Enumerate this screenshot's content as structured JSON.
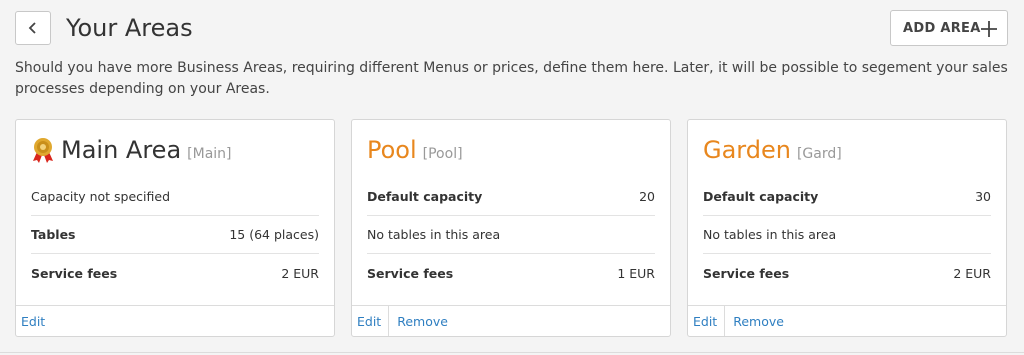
{
  "header": {
    "title": "Your Areas",
    "back_icon": "chevron-left-icon",
    "add_button": {
      "label": "ADD AREA",
      "icon": "plus-icon"
    }
  },
  "description": "Should you have more Business Areas, requiring different Menus or prices, define them here. Later, it will be possible to segement your sales processes depending on your Areas.",
  "colors": {
    "accent": "#e8871e",
    "link": "#2f7fc1",
    "main_badge_gold": "#e0a82e",
    "main_badge_ribbon": "#d9261c"
  },
  "areas": [
    {
      "name": "Main Area",
      "code": "[Main]",
      "icon": "medal-icon",
      "rows": [
        {
          "label": "Capacity not specified",
          "value": ""
        },
        {
          "label": "Tables",
          "value": "15 (64 places)"
        },
        {
          "label": "Service fees",
          "value": "2 EUR"
        }
      ],
      "actions": {
        "edit": "Edit"
      }
    },
    {
      "name": "Pool",
      "code": "[Pool]",
      "rows": [
        {
          "label": "Default capacity",
          "value": "20"
        },
        {
          "label": "No tables in this area",
          "value": ""
        },
        {
          "label": "Service fees",
          "value": "1 EUR"
        }
      ],
      "actions": {
        "edit": "Edit",
        "remove": "Remove"
      }
    },
    {
      "name": "Garden",
      "code": "[Gard]",
      "rows": [
        {
          "label": "Default capacity",
          "value": "30"
        },
        {
          "label": "No tables in this area",
          "value": ""
        },
        {
          "label": "Service fees",
          "value": "2 EUR"
        }
      ],
      "actions": {
        "edit": "Edit",
        "remove": "Remove"
      }
    }
  ]
}
